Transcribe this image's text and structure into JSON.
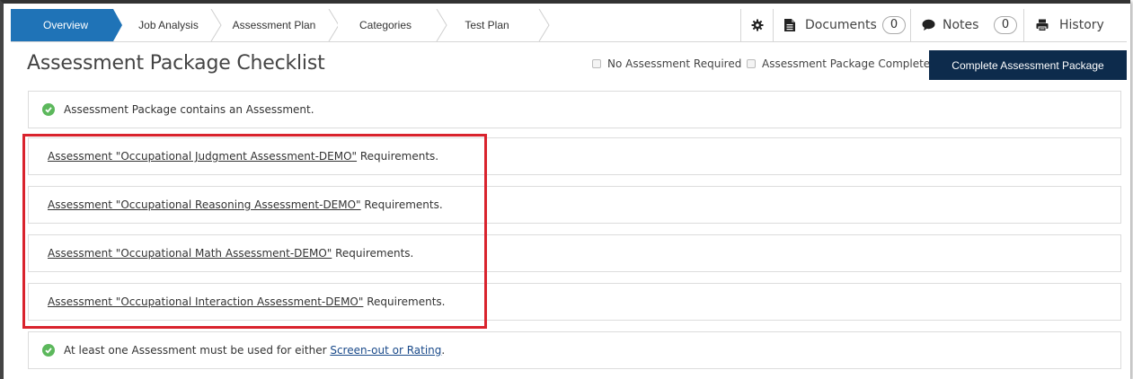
{
  "nav": {
    "steps": [
      {
        "label": "Overview",
        "active": true
      },
      {
        "label": "Job Analysis",
        "active": false
      },
      {
        "label": "Assessment Plan",
        "active": false
      },
      {
        "label": "Categories",
        "active": false
      },
      {
        "label": "Test Plan",
        "active": false
      }
    ],
    "tools": {
      "settings_icon": "gear-icon",
      "documents_label": "Documents",
      "documents_count": "0",
      "notes_label": "Notes",
      "notes_count": "0",
      "history_label": "History"
    }
  },
  "header": {
    "title": "Assessment Package Checklist",
    "no_assessment_label": "No Assessment Required",
    "package_complete_label": "Assessment Package Complete",
    "complete_button": "Complete Assessment Package"
  },
  "checklist": {
    "row1_text": "Assessment Package contains an Assessment.",
    "requirements": [
      {
        "link": "Assessment \"Occupational Judgment Assessment-DEMO\"",
        "suffix": " Requirements."
      },
      {
        "link": "Assessment \"Occupational Reasoning Assessment-DEMO\"",
        "suffix": " Requirements."
      },
      {
        "link": "Assessment \"Occupational Math Assessment-DEMO\"",
        "suffix": " Requirements."
      },
      {
        "link": "Assessment \"Occupational Interaction Assessment-DEMO\"",
        "suffix": " Requirements."
      }
    ],
    "last_row_prefix": "At least one Assessment must be used for either ",
    "last_row_link": "Screen-out or Rating",
    "last_row_suffix": "."
  },
  "colors": {
    "active_step": "#1f73b7",
    "primary_button": "#0d2b4c",
    "check_green": "#5cb85c",
    "highlight_red": "#d9232d"
  }
}
